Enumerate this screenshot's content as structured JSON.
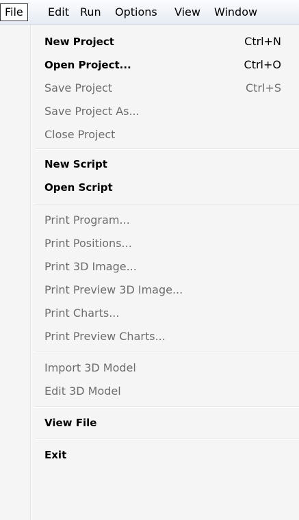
{
  "menubar": {
    "items": [
      {
        "label": "File",
        "active": true
      },
      {
        "label": "Edit",
        "active": false
      },
      {
        "label": "Run",
        "active": false
      },
      {
        "label": "Options",
        "active": false
      },
      {
        "label": "View",
        "active": false
      },
      {
        "label": "Window",
        "active": false
      }
    ]
  },
  "file_menu": {
    "groups": [
      [
        {
          "label": "New Project",
          "shortcut": "Ctrl+N",
          "enabled": true
        },
        {
          "label": "Open Project...",
          "shortcut": "Ctrl+O",
          "enabled": true
        },
        {
          "label": "Save Project",
          "shortcut": "Ctrl+S",
          "enabled": false
        },
        {
          "label": "Save  Project As...",
          "shortcut": "",
          "enabled": false
        },
        {
          "label": "Close Project",
          "shortcut": "",
          "enabled": false
        }
      ],
      [
        {
          "label": "New Script",
          "shortcut": "",
          "enabled": true
        },
        {
          "label": "Open Script",
          "shortcut": "",
          "enabled": true
        }
      ],
      [
        {
          "label": "Print Program...",
          "shortcut": "",
          "enabled": false
        },
        {
          "label": "Print Positions...",
          "shortcut": "",
          "enabled": false
        },
        {
          "label": "Print 3D Image...",
          "shortcut": "",
          "enabled": false
        },
        {
          "label": "Print Preview 3D Image...",
          "shortcut": "",
          "enabled": false
        },
        {
          "label": "Print Charts...",
          "shortcut": "",
          "enabled": false
        },
        {
          "label": "Print Preview Charts...",
          "shortcut": "",
          "enabled": false
        }
      ],
      [
        {
          "label": "Import 3D Model",
          "shortcut": "",
          "enabled": false
        },
        {
          "label": "Edit 3D Model",
          "shortcut": "",
          "enabled": false
        }
      ],
      [
        {
          "label": "View File",
          "shortcut": "",
          "enabled": true
        }
      ],
      [
        {
          "label": "Exit",
          "shortcut": "",
          "enabled": true
        }
      ]
    ]
  },
  "colors": {
    "enabled_text": "#000000",
    "disabled_text": "#6d6d6d",
    "menu_background": "#f5f5f5"
  }
}
